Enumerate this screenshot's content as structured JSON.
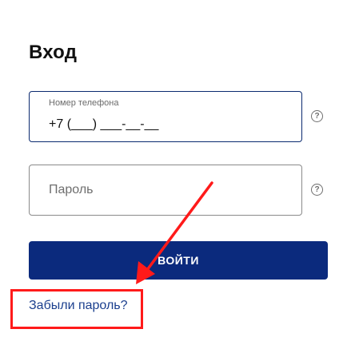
{
  "heading": "Вход",
  "phone_field": {
    "label": "Номер телефона",
    "value": "+7 (___) ___-__-__"
  },
  "password_field": {
    "placeholder": "Пароль"
  },
  "help_icon_glyph": "?",
  "login_button": "ВОЙТИ",
  "forgot_password_link": "Забыли пароль?",
  "annotation": {
    "color": "#ff1a1a"
  },
  "colors": {
    "primary": "#0b2a7d",
    "link": "#1b3f8e"
  }
}
